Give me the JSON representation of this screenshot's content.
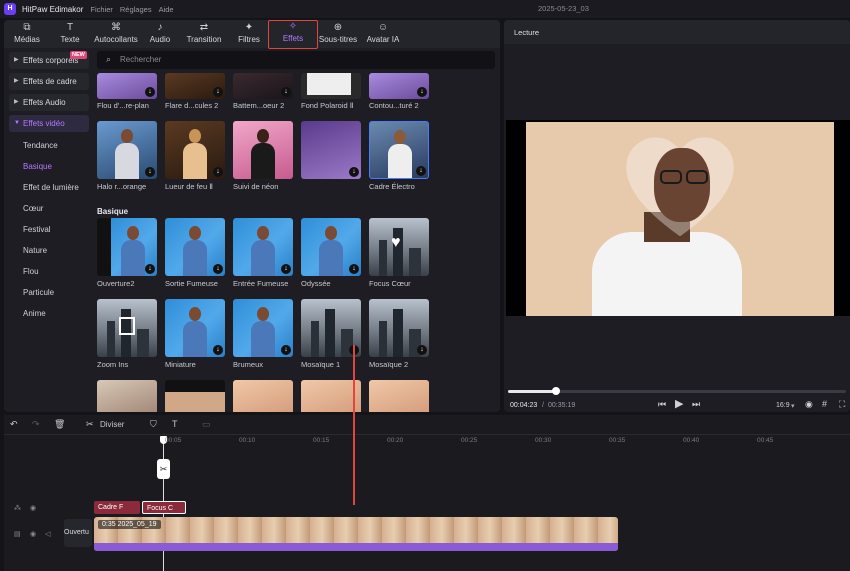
{
  "titlebar": {
    "app_name": "HitPaw Edimakor",
    "menu": [
      "Fichier",
      "Réglages",
      "Aide"
    ],
    "project_title": "2025-05-23_03"
  },
  "toolbar": {
    "tabs": [
      {
        "label": "Médias",
        "icon": "media-icon"
      },
      {
        "label": "Texte",
        "icon": "text-icon"
      },
      {
        "label": "Autocollants",
        "icon": "sticker-icon"
      },
      {
        "label": "Audio",
        "icon": "music-icon"
      },
      {
        "label": "Transition",
        "icon": "transition-icon"
      },
      {
        "label": "Filtres",
        "icon": "filter-icon"
      },
      {
        "label": "Effets",
        "icon": "effects-icon"
      },
      {
        "label": "Sous-titres",
        "icon": "subtitles-icon"
      },
      {
        "label": "Avatar IA",
        "icon": "avatar-icon"
      }
    ],
    "active_tab": "Effets",
    "accent_color": "#b47bff"
  },
  "sidebar": {
    "categories": [
      {
        "label": "Effets corporels",
        "badge": "NEW"
      },
      {
        "label": "Effets de cadre"
      },
      {
        "label": "Effets Audio"
      },
      {
        "label": "Effets vidéo",
        "active": true
      }
    ],
    "subcategories": [
      "Tendance",
      "Basique",
      "Effet de lumière",
      "Cœur",
      "Festival",
      "Nature",
      "Flou",
      "Particule",
      "Anime"
    ],
    "active_sub": "Basique"
  },
  "search": {
    "placeholder": "Rechercher"
  },
  "effects": {
    "row1": [
      "Flou d'...re-plan",
      "Flare d...cules 2",
      "Battem...oeur 2",
      "Fond Polaroid Ⅱ",
      "Contou...turé 2"
    ],
    "row2": [
      "Halo r...orange",
      "Lueur de feu Ⅱ",
      "Suivi de néon",
      "",
      "Cadre Électro"
    ],
    "section_title": "Basique",
    "row3": [
      "Ouverture2",
      "Sortie Fumeuse",
      "Entrée Fumeuse",
      "Odyssée",
      "Focus Cœur"
    ],
    "row4": [
      "Zoom Ins",
      "Miniature",
      "Brumeux",
      "Mosaïque 1",
      "Mosaïque 2"
    ]
  },
  "preview": {
    "header": "Lecture",
    "current_time": "00:04:23",
    "total_time": "00:35:19",
    "progress_fraction": 0.14,
    "aspect": "16:9"
  },
  "timeline": {
    "split_label": "Diviser",
    "ticks": [
      "00:05",
      "00:10",
      "00:15",
      "00:20",
      "00:25",
      "00:30",
      "00:35",
      "00:40",
      "00:45"
    ],
    "fx_clips": [
      "Cadre F",
      "Focus C"
    ],
    "video_clip_label": "0:35 2025_05_19",
    "chip_label": "Ouvertu",
    "clip_color": "#8a5bd4",
    "fx_color": "#8a2a3a"
  }
}
